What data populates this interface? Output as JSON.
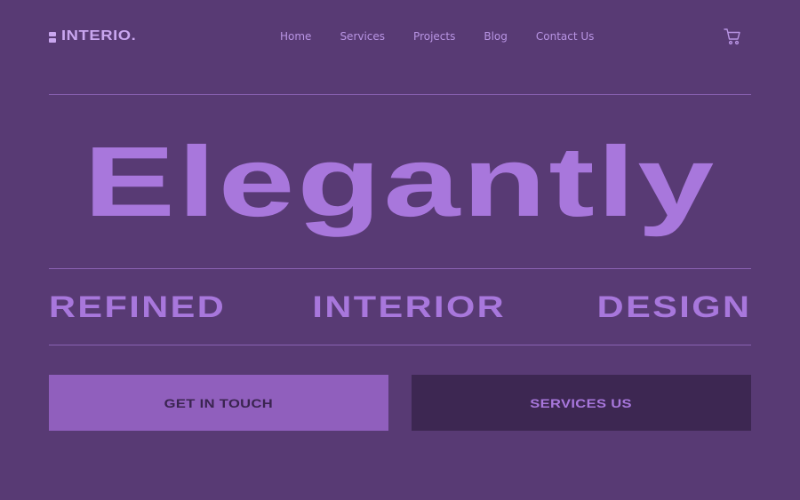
{
  "header": {
    "logo_text": "INTERIO.",
    "nav": [
      {
        "label": "Home"
      },
      {
        "label": "Services"
      },
      {
        "label": "Projects"
      },
      {
        "label": "Blog"
      },
      {
        "label": "Contact Us"
      }
    ],
    "cart_icon": "cart-icon"
  },
  "hero": {
    "headline": "Elegantly",
    "subline": [
      "REFINED",
      "INTERIOR",
      "DESIGN"
    ]
  },
  "actions": {
    "primary_label": "GET IN TOUCH",
    "secondary_label": "SERVICES US"
  },
  "colors": {
    "background": "#583a74",
    "accent": "#a877dc",
    "nav_text": "#b894e3",
    "primary_button": "#905fbd",
    "secondary_button": "#3d2752"
  }
}
